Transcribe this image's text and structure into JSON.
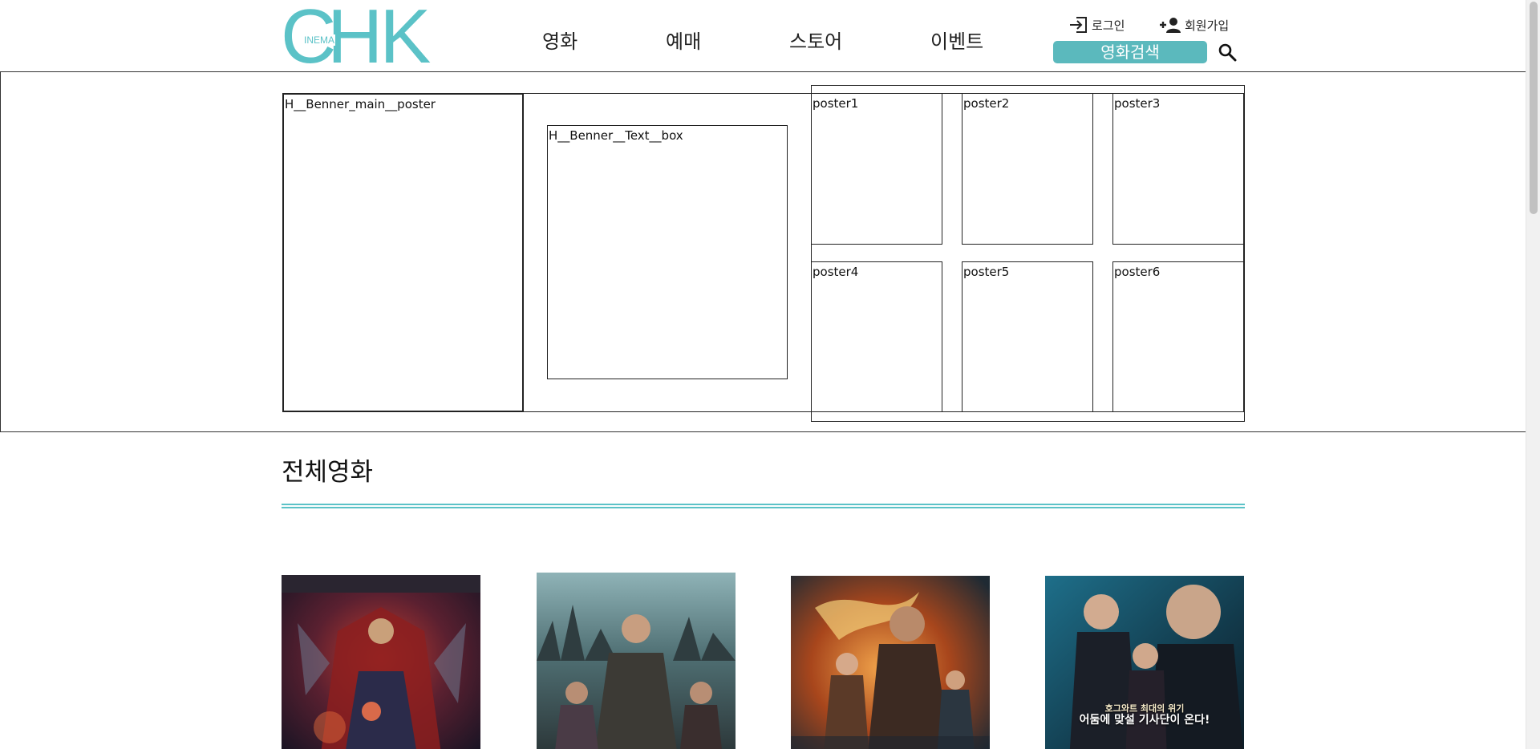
{
  "header": {
    "logo": {
      "big_c": "C",
      "big_hk": "HK",
      "small": "INEMA"
    },
    "nav": [
      {
        "label": "영화"
      },
      {
        "label": "예매"
      },
      {
        "label": "스토어"
      },
      {
        "label": "이벤트"
      }
    ],
    "login_label": "로그인",
    "signup_label": "회원가입",
    "search_button_label": "영화검색",
    "icons": {
      "login": "login-icon",
      "signup": "add-user-icon",
      "search": "search-icon"
    }
  },
  "banner": {
    "main_poster_label": "H__Benner_main__poster",
    "text_box_label": "H__Benner__Text__box",
    "posters": [
      "poster1",
      "poster2",
      "poster3",
      "poster4",
      "poster5",
      "poster6"
    ]
  },
  "section": {
    "title": "전체영화"
  },
  "movies": [
    {
      "caption_line1": "",
      "caption_line2": ""
    },
    {
      "caption_line1": "",
      "caption_line2": ""
    },
    {
      "caption_line1": "",
      "caption_line2": ""
    },
    {
      "caption_line1": "호그와트 최대의 위기",
      "caption_line2": "어둠에 맞설 기사단이 온다!"
    }
  ],
  "colors": {
    "accent": "#5bc2c7",
    "search_button": "#5bb9bd"
  }
}
